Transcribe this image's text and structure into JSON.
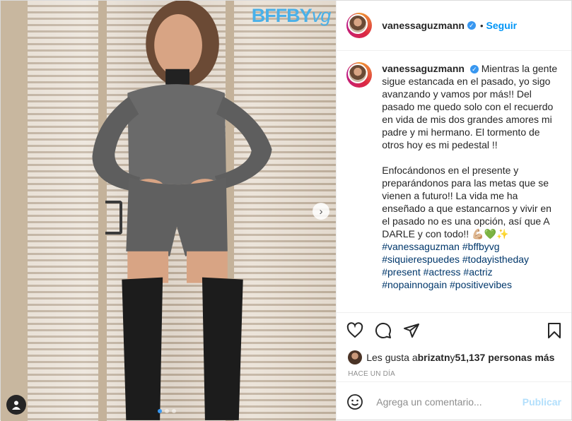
{
  "photo": {
    "brand_logo": "BFFBY",
    "brand_logo_script": "vg",
    "next_icon": "chevron-right-icon",
    "user_tag_icon": "person-icon",
    "carousel_total": 3,
    "carousel_active": 1
  },
  "header": {
    "username": "vanessaguzmann",
    "verified_icon": "verified-badge-icon",
    "separator": "•",
    "follow_label": "Seguir"
  },
  "caption": {
    "username": "vanessaguzmann",
    "paragraph1": "Mientras la gente sigue estancada en el pasado, yo sigo avanzando y vamos por más!! Del pasado me quedo solo con el recuerdo en vida de mis dos grandes amores mi padre y mi hermano. El tormento de otros hoy es mi pedestal !!",
    "paragraph2": "Enfocándonos en el presente y preparándonos para las metas que se vienen a futuro!! La vida me ha enseñado a que estancarnos y vivir en el pasado no es una opción, así que A DARLE y con todo!! 💪🏼💚✨",
    "hashtags": [
      "#vanessaguzman",
      "#bffbyvg",
      "#siquierespuedes",
      "#todayistheday",
      "#present",
      "#actress",
      "#actriz",
      "#nopainnogain",
      "#positivevibes"
    ]
  },
  "actions": {
    "like_icon": "heart-icon",
    "comment_icon": "comment-bubble-icon",
    "share_icon": "paper-plane-icon",
    "save_icon": "bookmark-icon"
  },
  "likes": {
    "prefix": "Les gusta a ",
    "user": "brizatn",
    "middle": " y ",
    "count": "51,137 personas más"
  },
  "timestamp": "HACE UN DÍA",
  "comment": {
    "emoji_icon": "smiley-icon",
    "placeholder": "Agrega un comentario...",
    "publish_label": "Publicar"
  },
  "colors": {
    "accent": "#0095f6",
    "publish_disabled": "#b2dffc",
    "brand_logo": "#4ab0e8",
    "hashtag": "#00376b",
    "muted": "#8e8e8e"
  }
}
